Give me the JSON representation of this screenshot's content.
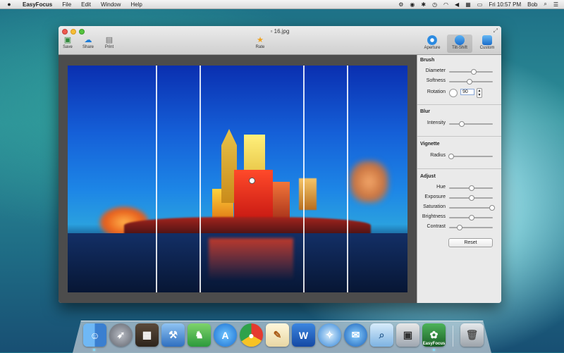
{
  "menubar": {
    "app_name": "EasyFocus",
    "menus": [
      "File",
      "Edit",
      "Window",
      "Help"
    ],
    "clock": "Fri 10:57 PM",
    "user": "Bob"
  },
  "window": {
    "title": "16.jpg",
    "toolbar": {
      "save": "Save",
      "share": "Share",
      "print": "Print",
      "rate": "Rate"
    },
    "modes": {
      "aperture": "Aperture",
      "tilt_shift": "Tilt-Shift",
      "custom": "Custom"
    }
  },
  "panel": {
    "brush": {
      "title": "Brush",
      "diameter_label": "Diameter",
      "diameter_value": 0.55,
      "softness_label": "Softness",
      "softness_value": 0.45,
      "rotation_label": "Rotation",
      "rotation_value": "90"
    },
    "blur": {
      "title": "Blur",
      "intensity_label": "Intensity",
      "intensity_value": 0.28
    },
    "vignette": {
      "title": "Vignette",
      "radius_label": "Radius",
      "radius_value": 0.04
    },
    "adjust": {
      "title": "Adjust",
      "hue_label": "Hue",
      "hue_value": 0.5,
      "exposure_label": "Exposure",
      "exposure_value": 0.5,
      "saturation_label": "Saturation",
      "saturation_value": 0.97,
      "brightness_label": "Brightness",
      "brightness_value": 0.5,
      "contrast_label": "Contrast",
      "contrast_value": 0.22,
      "reset_label": "Reset"
    }
  },
  "dock": {
    "items": [
      "Finder",
      "Launchpad",
      "Photo Booth",
      "Xcode",
      "Evernote",
      "App Store",
      "Chrome",
      "TextEdit",
      "Word",
      "Safari",
      "Thunderbird",
      "Preview",
      "Image Capture",
      "EasyFocus",
      "Trash"
    ],
    "easyfocus_label": "EasyFocus"
  }
}
